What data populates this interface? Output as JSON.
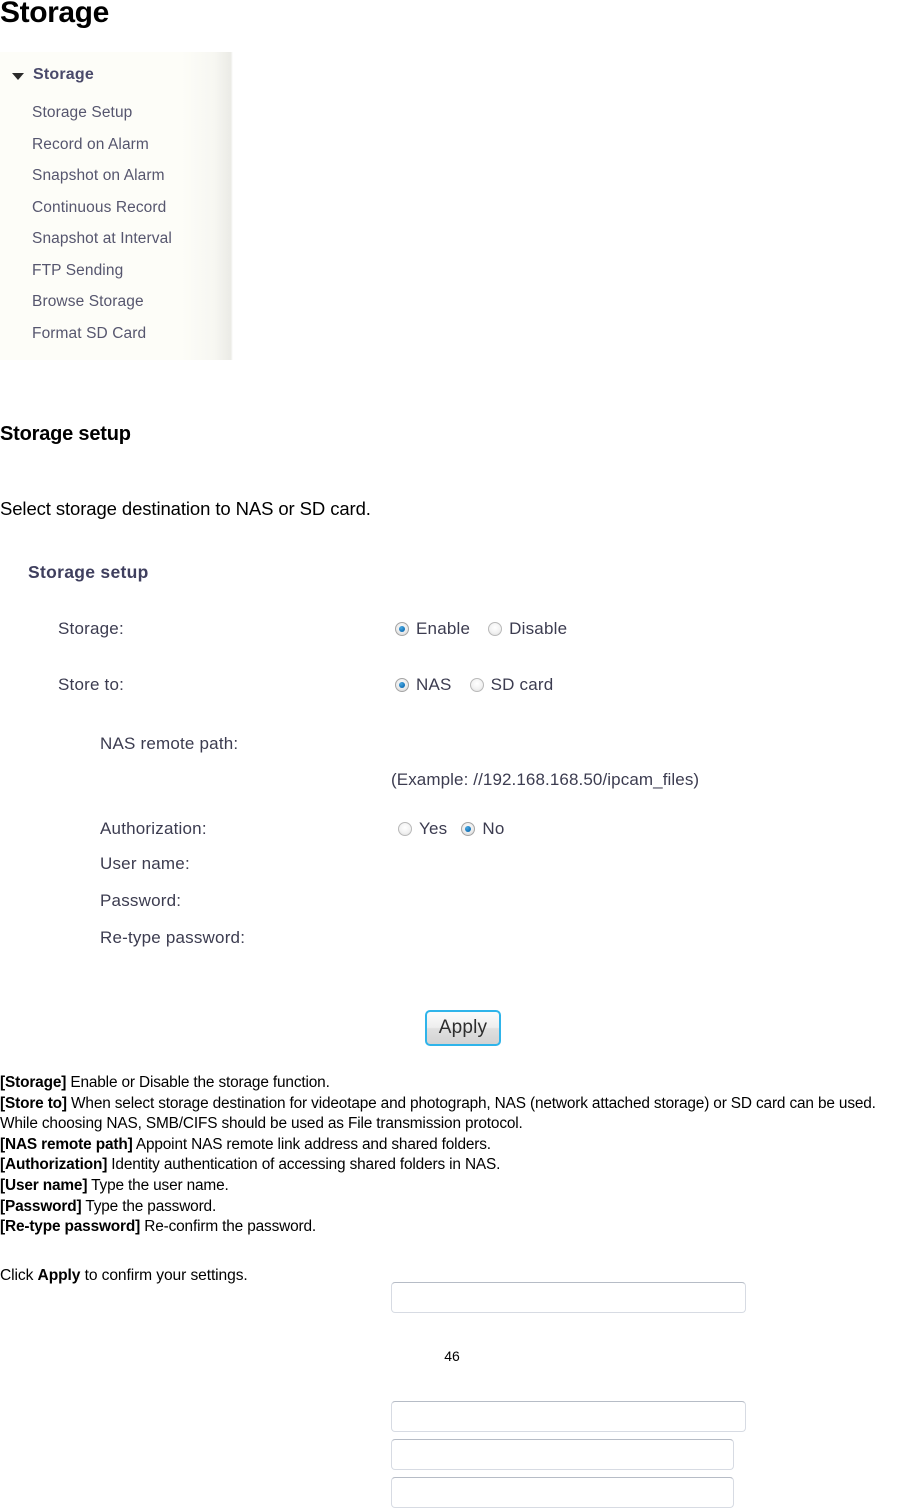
{
  "document": {
    "page_title": "Storage",
    "page_number": "46"
  },
  "sidebar": {
    "root_label": "Storage",
    "expand_icon": "triangle-down-icon",
    "items": [
      {
        "label": "Storage Setup"
      },
      {
        "label": "Record on Alarm"
      },
      {
        "label": "Snapshot on Alarm"
      },
      {
        "label": "Continuous Record"
      },
      {
        "label": "Snapshot at Interval"
      },
      {
        "label": "FTP Sending"
      },
      {
        "label": "Browse Storage"
      },
      {
        "label": "Format SD Card"
      }
    ]
  },
  "section": {
    "heading": "Storage setup",
    "intro": "Select storage destination to NAS or SD card."
  },
  "form": {
    "heading": "Storage setup",
    "storage": {
      "label": "Storage:",
      "options": [
        {
          "label": "Enable",
          "selected": true
        },
        {
          "label": "Disable",
          "selected": false
        }
      ]
    },
    "store_to": {
      "label": "Store to:",
      "options": [
        {
          "label": "NAS",
          "selected": true
        },
        {
          "label": "SD card",
          "selected": false
        }
      ]
    },
    "nas_remote_path": {
      "label": "NAS remote path:",
      "value": "",
      "placeholder": "",
      "example": "(Example: //192.168.168.50/ipcam_files)"
    },
    "authorization": {
      "label": "Authorization:",
      "options": [
        {
          "label": "Yes",
          "selected": false
        },
        {
          "label": "No",
          "selected": true
        }
      ]
    },
    "user_name": {
      "label": "User name:",
      "value": "",
      "placeholder": ""
    },
    "password": {
      "label": "Password:",
      "value": "",
      "placeholder": ""
    },
    "retype_password": {
      "label": "Re-type password:",
      "value": "",
      "placeholder": ""
    },
    "apply_button": "Apply"
  },
  "descriptions": [
    {
      "term": "[Storage]",
      "text": " Enable or Disable the storage function."
    },
    {
      "term": "[Store to]",
      "text": " When select storage destination for videotape and photograph, NAS (network attached storage) or SD card can be used. While choosing NAS, SMB/CIFS should be used as File transmission protocol."
    },
    {
      "term": "[NAS remote path]",
      "text": " Appoint NAS remote link address and shared folders."
    },
    {
      "term": "[Authorization]",
      "text": " Identity authentication of accessing shared folders in NAS."
    },
    {
      "term": "[User name]",
      "text": " Type the user name."
    },
    {
      "term": "[Password]",
      "text": " Type the password."
    },
    {
      "term": "[Re-type password]",
      "text": " Re-confirm the password."
    }
  ],
  "closing": {
    "prefix": "Click ",
    "bold": "Apply",
    "suffix": " to confirm your settings."
  },
  "colors": {
    "accent_blue": "#1372b8",
    "button_border": "#2fb4ea",
    "menu_text": "#56566e",
    "panel_bg": "#fdfdf8"
  }
}
